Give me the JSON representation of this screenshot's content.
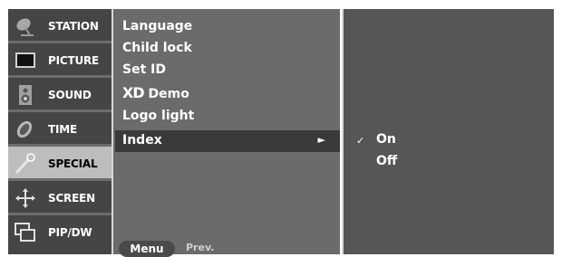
{
  "categories": [
    {
      "label": "STATION",
      "icon": "satellite-dish-icon",
      "selected": false
    },
    {
      "label": "PICTURE",
      "icon": "monitor-icon",
      "selected": false
    },
    {
      "label": "SOUND",
      "icon": "speaker-icon",
      "selected": false
    },
    {
      "label": "TIME",
      "icon": "clock-icon",
      "selected": false
    },
    {
      "label": "SPECIAL",
      "icon": "magic-wand-icon",
      "selected": true
    },
    {
      "label": "SCREEN",
      "icon": "arrows-icon",
      "selected": false
    },
    {
      "label": "PIP/DW",
      "icon": "pip-window-icon",
      "selected": false
    }
  ],
  "menu": {
    "items": [
      "Language",
      "Child lock",
      "Set ID",
      "Demo",
      "Logo light",
      "Index"
    ],
    "xd_logo": "XD",
    "selected": "Index",
    "arrow": "►"
  },
  "footer": {
    "menu_button": "Menu",
    "prev_label": "Prev."
  },
  "submenu": {
    "options": [
      "On",
      "Off"
    ],
    "checked": "On",
    "check_glyph": "✓"
  },
  "colors": {
    "category_bg": "#454545",
    "category_selected": "#bdbdbd",
    "menu_bg": "#6b6b6b",
    "highlight_row": "#3a3a3a",
    "submenu_bg": "#565656"
  }
}
